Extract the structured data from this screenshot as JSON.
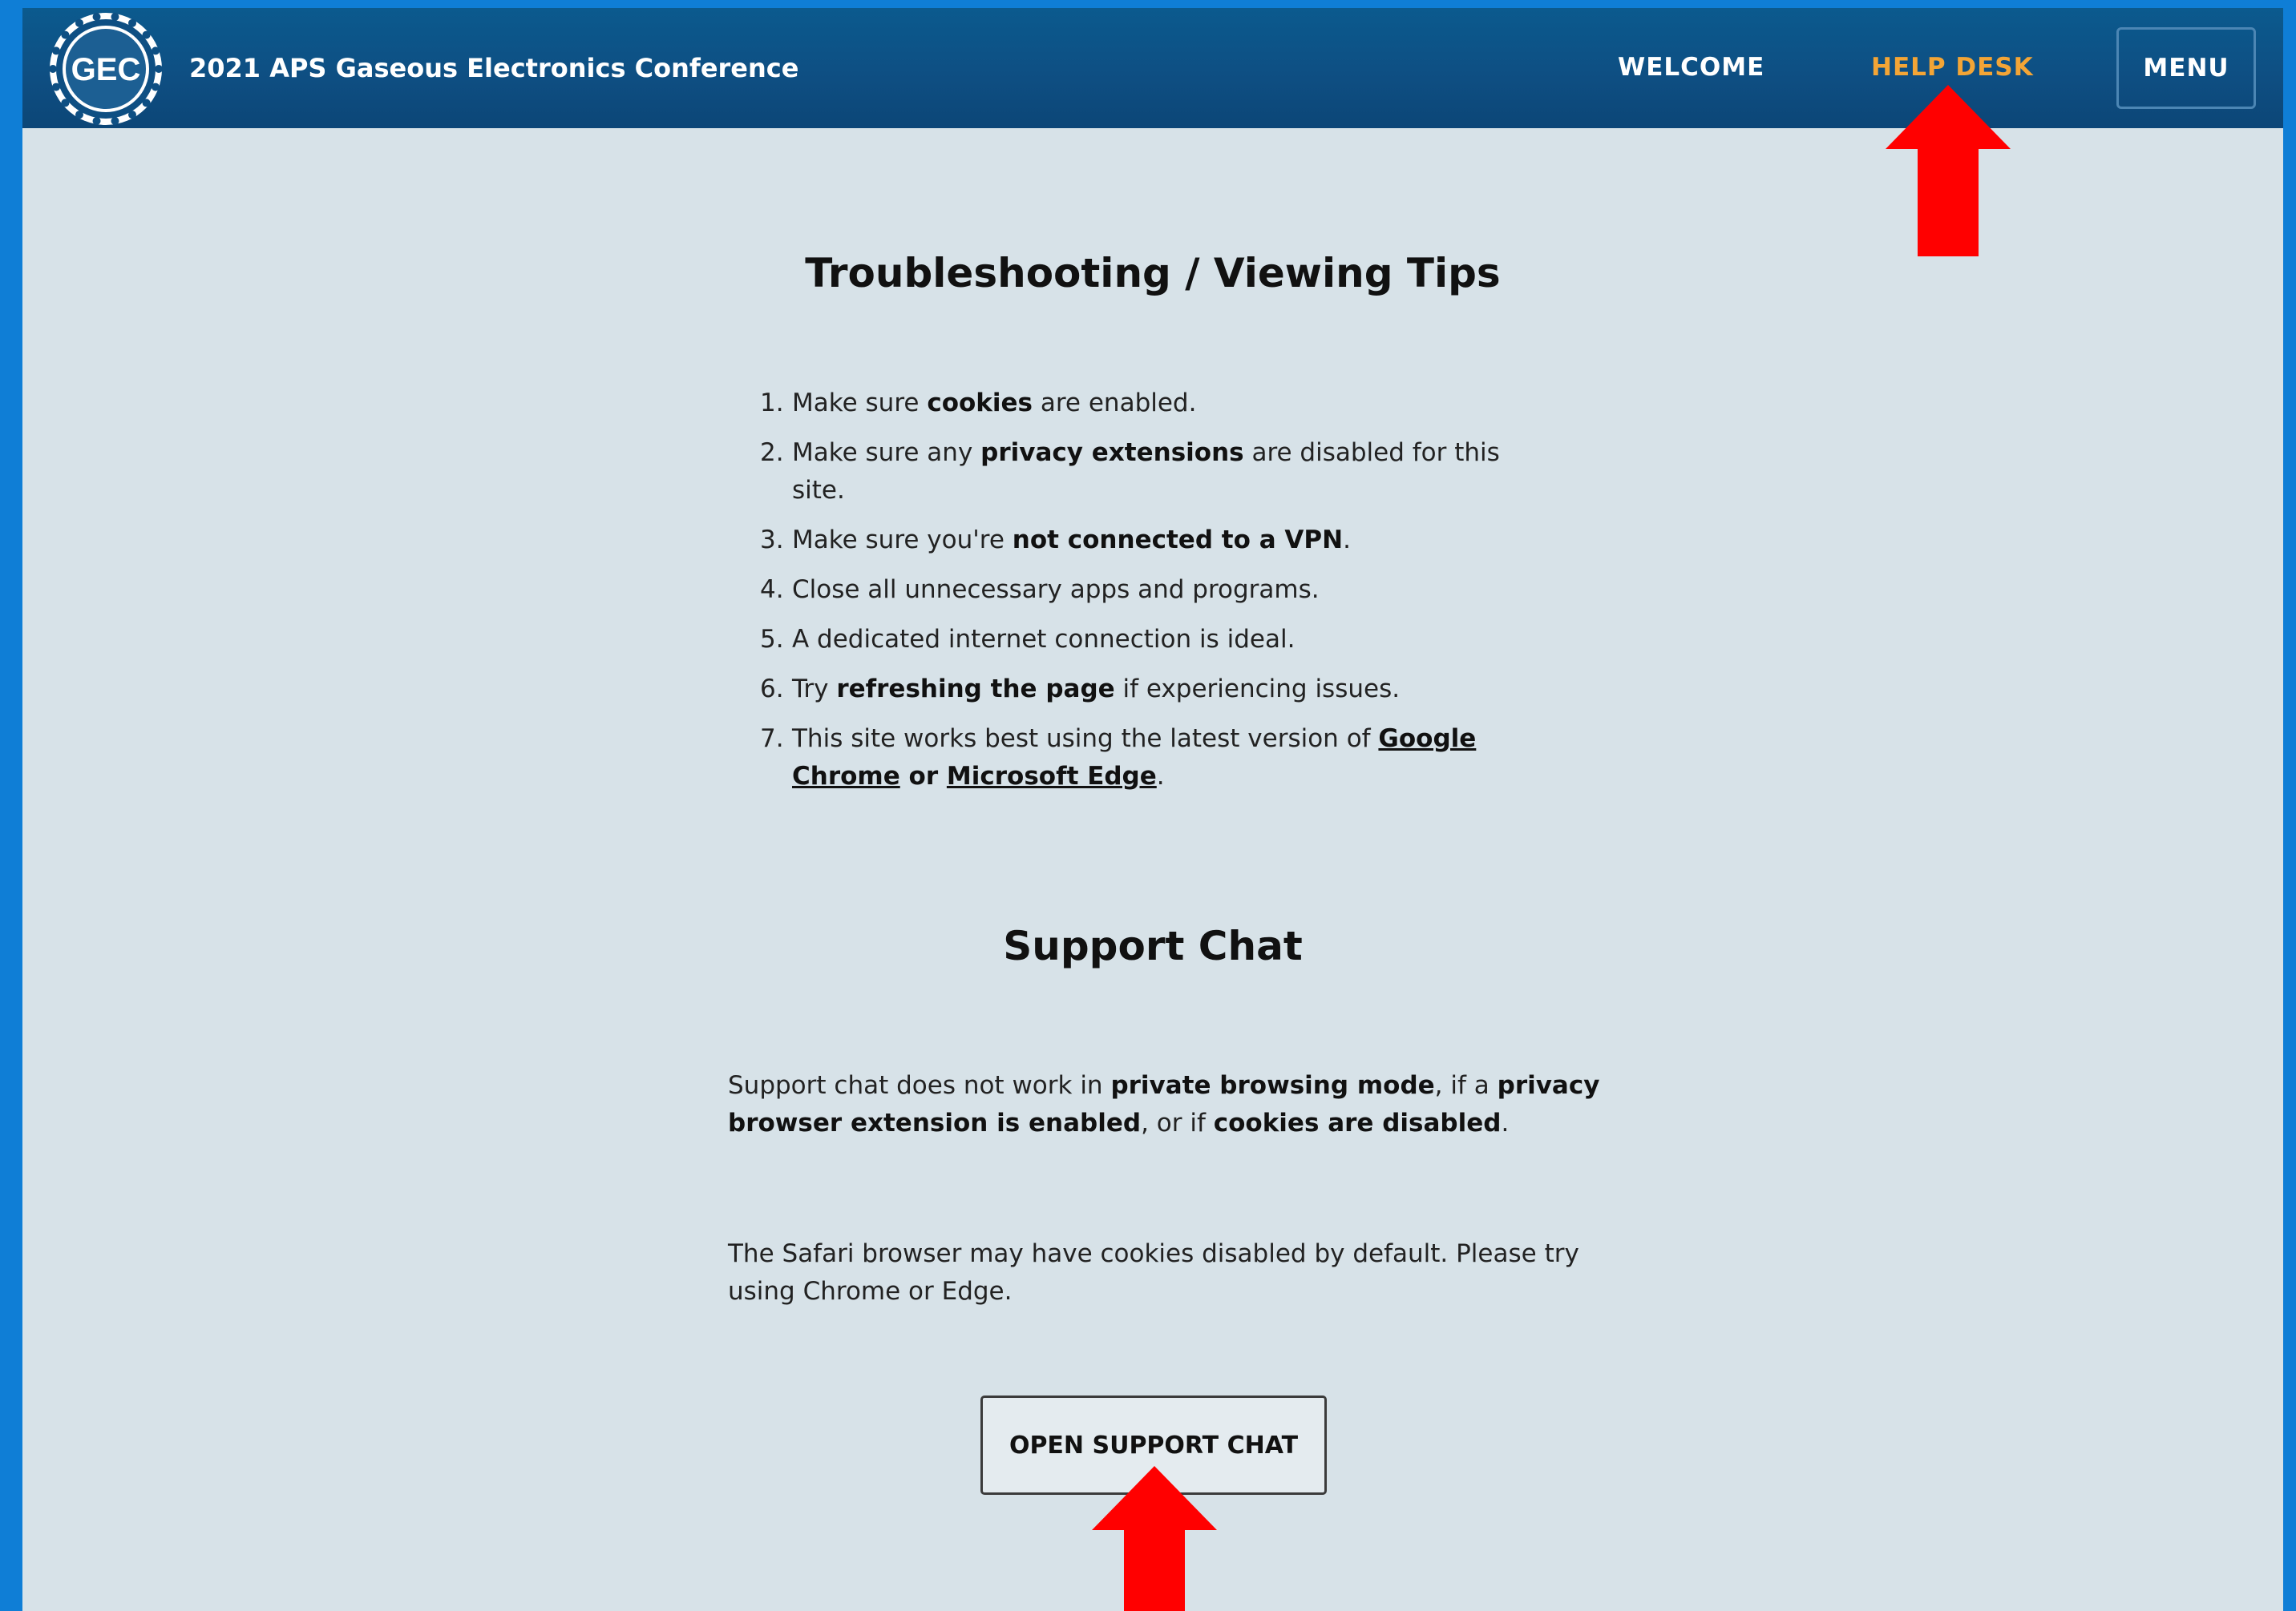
{
  "header": {
    "logo_text": "GEC",
    "title": "2021 APS Gaseous Electronics Conference",
    "nav": {
      "welcome": "WELCOME",
      "help_desk": "HELP DESK",
      "menu": "MENU"
    },
    "active_color": "#f3a536",
    "bar_color": "#0e4f83"
  },
  "tips": {
    "heading": "Troubleshooting / Viewing Tips",
    "items": [
      {
        "num": "1.",
        "pre": "Make sure ",
        "bold": "cookies",
        "post": " are enabled."
      },
      {
        "num": "2.",
        "pre": "Make sure any ",
        "bold": "privacy extensions",
        "post": " are disabled for this site."
      },
      {
        "num": "3.",
        "pre": "Make sure you're ",
        "bold": "not connected to a VPN",
        "post": "."
      },
      {
        "num": "4.",
        "text": "Close all unnecessary apps and programs."
      },
      {
        "num": "5.",
        "text": "A dedicated internet connection is ideal."
      },
      {
        "num": "6.",
        "pre": "Try ",
        "bold": "refreshing the page",
        "post": " if experiencing issues."
      },
      {
        "num": "7.",
        "pre": "This site works best using the latest version of ",
        "link1": "Google Chrome",
        "mid": " or ",
        "link2": "Microsoft Edge",
        "post": "."
      }
    ]
  },
  "support": {
    "heading": "Support Chat",
    "para1": {
      "t1": "Support chat does not work in ",
      "b1": "private browsing mode",
      "t2": ", if a ",
      "b2": "privacy browser extension is enabled",
      "t3": ", or if ",
      "b3": "cookies are disabled",
      "t4": "."
    },
    "para2": "The Safari browser may have cookies disabled by default. Please try using Chrome or Edge.",
    "button": "OPEN SUPPORT CHAT"
  },
  "annotations": {
    "arrow_color": "#ff0000"
  }
}
